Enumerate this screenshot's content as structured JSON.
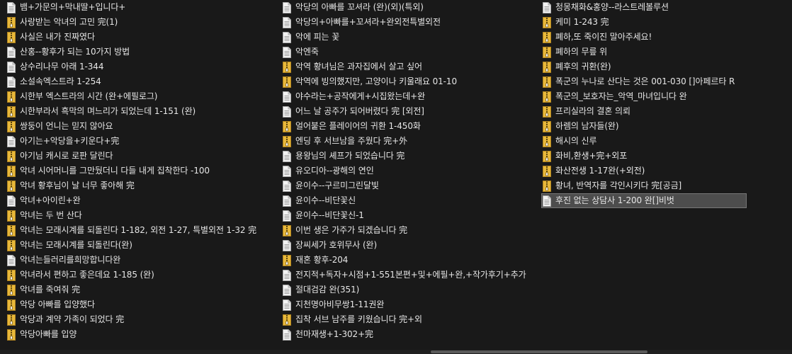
{
  "colors": {
    "background": "#191919",
    "text": "#e6e6e6",
    "selection": "#4d4d4d",
    "zip_icon": "#e8b83a",
    "doc_icon": "#f2f2f2"
  },
  "columns": [
    {
      "items": [
        {
          "name": "뱀+가문의+막내딸+입니다+",
          "icon": "text-file-icon"
        },
        {
          "name": "사랑받는 악녀의 고민 完(1)",
          "icon": "zip-file-icon"
        },
        {
          "name": "사실은 내가 진짜였다",
          "icon": "zip-file-icon"
        },
        {
          "name": "산홍--황후가 되는 10가지 방법",
          "icon": "text-file-icon"
        },
        {
          "name": "상수리나무 아래 1-344",
          "icon": "text-file-icon"
        },
        {
          "name": "소설속엑스트라 1-254",
          "icon": "text-file-icon"
        },
        {
          "name": "시한부 엑스트라의 시간 (완+에필로그)",
          "icon": "zip-file-icon"
        },
        {
          "name": "시한부라서 흑막의 며느리가 되었는데 1-151 (완)",
          "icon": "zip-file-icon"
        },
        {
          "name": "쌍둥이 언니는 믿지 않아요",
          "icon": "zip-file-icon"
        },
        {
          "name": "아기는+악당을+키운다+完",
          "icon": "text-file-icon"
        },
        {
          "name": "아기님 캐시로 로판 달린다",
          "icon": "zip-file-icon"
        },
        {
          "name": "악녀 시어머니를 그만뒀더니 다들 내게 집착한다 -100",
          "icon": "zip-file-icon"
        },
        {
          "name": "악녀 황후님이 날 너무 좋아해 完",
          "icon": "zip-file-icon"
        },
        {
          "name": "악녀+아이린+완",
          "icon": "text-file-icon"
        },
        {
          "name": "악녀는 두 번 산다",
          "icon": "zip-file-icon"
        },
        {
          "name": "악녀는 모래시계를 되돌린다 1-182, 외전 1-27, 특별외전 1-32 完",
          "icon": "zip-file-icon"
        },
        {
          "name": "악녀는 모래시계를 되돌린다(완)",
          "icon": "zip-file-icon"
        },
        {
          "name": "악녀는들러리를희망합니다완",
          "icon": "text-file-icon"
        },
        {
          "name": "악녀라서 편하고 좋은데요 1-185 (완)",
          "icon": "zip-file-icon"
        },
        {
          "name": "악녀를 죽여줘 完",
          "icon": "zip-file-icon"
        },
        {
          "name": "악당 아빠를 입양했다",
          "icon": "zip-file-icon"
        },
        {
          "name": "악당과 계약 가족이 되었다 完",
          "icon": "zip-file-icon"
        },
        {
          "name": "악당아빠를 입양",
          "icon": "zip-file-icon"
        }
      ]
    },
    {
      "items": [
        {
          "name": "악당의 아빠를 꼬셔라 (완)(외)(특외)",
          "icon": "text-file-icon"
        },
        {
          "name": "악당의+아빠를+꼬셔라+완외전특별외전",
          "icon": "text-file-icon"
        },
        {
          "name": "악에 피는 꽃",
          "icon": "text-file-icon"
        },
        {
          "name": "악엔죽",
          "icon": "text-file-icon"
        },
        {
          "name": "악역 황녀님은 과자집에서 살고 싶어",
          "icon": "zip-file-icon"
        },
        {
          "name": "악역에 빙의했지만, 고양이나 키울래요 01-10",
          "icon": "zip-file-icon"
        },
        {
          "name": "야수라는+공작에게+시집왔는데+완",
          "icon": "text-file-icon"
        },
        {
          "name": "어느 날 공주가 되어버렸다 完 [외전]",
          "icon": "text-file-icon"
        },
        {
          "name": "얼어붙은 플레이어의 귀환 1-450화",
          "icon": "zip-file-icon"
        },
        {
          "name": "엔딩 후 서브남을 주웠다 完+外",
          "icon": "zip-file-icon"
        },
        {
          "name": "용왕님의 셰프가 되었습니다 完",
          "icon": "text-file-icon"
        },
        {
          "name": "유오디아--광해의 연인",
          "icon": "text-file-icon"
        },
        {
          "name": "윤이수--구르미그린달빛",
          "icon": "text-file-icon"
        },
        {
          "name": "윤이수--비단꽃신",
          "icon": "text-file-icon"
        },
        {
          "name": "윤이수--비단꽃신-1",
          "icon": "text-file-icon"
        },
        {
          "name": "이번 생은 가주가 되겠습니다 完",
          "icon": "zip-file-icon"
        },
        {
          "name": "장씨세가 호위무사 (완)",
          "icon": "text-file-icon"
        },
        {
          "name": "재혼 황후-204",
          "icon": "zip-file-icon"
        },
        {
          "name": "전지적+독자+시점+1-551본편+및+에필+완,+작가후기+추가",
          "icon": "text-file-icon"
        },
        {
          "name": "절대검감 완(351)",
          "icon": "text-file-icon"
        },
        {
          "name": "지천명아비무쌍1-11권완",
          "icon": "text-file-icon"
        },
        {
          "name": "집착 서브 남주를 키웠습니다 完+외",
          "icon": "zip-file-icon"
        },
        {
          "name": "천마재생+1-302+完",
          "icon": "text-file-icon"
        }
      ]
    },
    {
      "items": [
        {
          "name": "청몽채화&홍양--라스트레볼루션",
          "icon": "text-file-icon"
        },
        {
          "name": "케미 1-243 完",
          "icon": "zip-file-icon"
        },
        {
          "name": "폐하,또 죽이진 말아주세요!",
          "icon": "zip-file-icon"
        },
        {
          "name": "폐하의 무릎 위",
          "icon": "zip-file-icon"
        },
        {
          "name": "폐후의 귀환(완)",
          "icon": "zip-file-icon"
        },
        {
          "name": "폭군의 누나로 산다는 것은 001-030 []아페르타 R",
          "icon": "zip-file-icon"
        },
        {
          "name": "폭군의_보호자는_악역_마녀입니다 완",
          "icon": "zip-file-icon"
        },
        {
          "name": "프리실라의 결혼 의뢰",
          "icon": "zip-file-icon"
        },
        {
          "name": "하렘의 남자들(완)",
          "icon": "zip-file-icon"
        },
        {
          "name": "해시의 신루",
          "icon": "zip-file-icon"
        },
        {
          "name": "화비,환생+完+외포",
          "icon": "zip-file-icon"
        },
        {
          "name": "화산전생 1-17완(+외전)",
          "icon": "zip-file-icon"
        },
        {
          "name": "황녀, 반역자를 각인시키다 完[공금]",
          "icon": "zip-file-icon"
        },
        {
          "name": "후진 없는 상담사 1-200 완[]비벗",
          "icon": "text-file-icon",
          "selected": true
        }
      ]
    }
  ]
}
